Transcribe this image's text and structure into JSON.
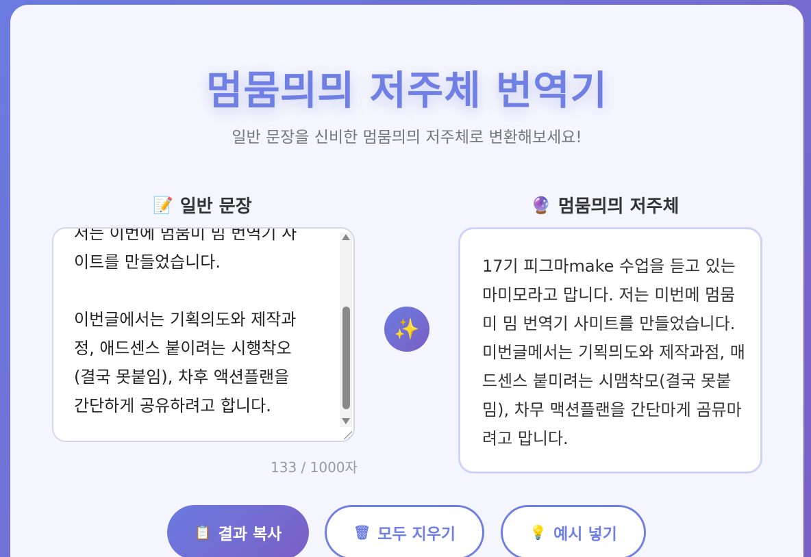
{
  "header": {
    "title": "멈뭄믜믜 저주체 번역기",
    "subtitle": "일반 문장을 신비한 멈뭄믜믜 저주체로 변환해보세요!"
  },
  "input_panel": {
    "icon": "memo-icon",
    "icon_glyph": "📝",
    "label": "일반 문장",
    "text": "저는 이번에 멈뭄미 밈 번역기 사\n이트를 만들었습니다.\n\n이번글에서는 기획의도와 제작과\n정, 애드센스 붙이려는 시행착오\n(결국 못붙임), 차후 액션플랜을\n간단하게 공유하려고 합니다.",
    "char_count": "133 / 1000자"
  },
  "output_panel": {
    "icon": "crystal-ball-icon",
    "icon_glyph": "🔮",
    "label": "멈뭄믜믜 저주체",
    "text": "17기 피그마make 수업을 듣고 있는 마미모라고 맙니다. 저는 미번메 멈뭄미 밈 번역기 사미트를 만들었습니다. 미번글메서는 기뫽믜도와 제작과점, 매드센스 붙미려는 시맴착모(결국 못붙밈), 차무 맥션플랜을 간단마게 곰뮤마려고 맙니다."
  },
  "convert_icon": {
    "icon": "sparkles-icon",
    "glyph": "✨"
  },
  "buttons": {
    "copy": {
      "icon": "clipboard-icon",
      "glyph": "📋",
      "label": "결과 복사"
    },
    "clear": {
      "icon": "wastebasket-icon",
      "glyph": "🗑",
      "label": "모두 지우기"
    },
    "example": {
      "icon": "lightbulb-icon",
      "glyph": "💡",
      "label": "예시 넣기"
    }
  },
  "colors": {
    "accent": "#6f7fe3",
    "accent_dark": "#7b5fc4",
    "card_bg": "#f5f6fd"
  }
}
